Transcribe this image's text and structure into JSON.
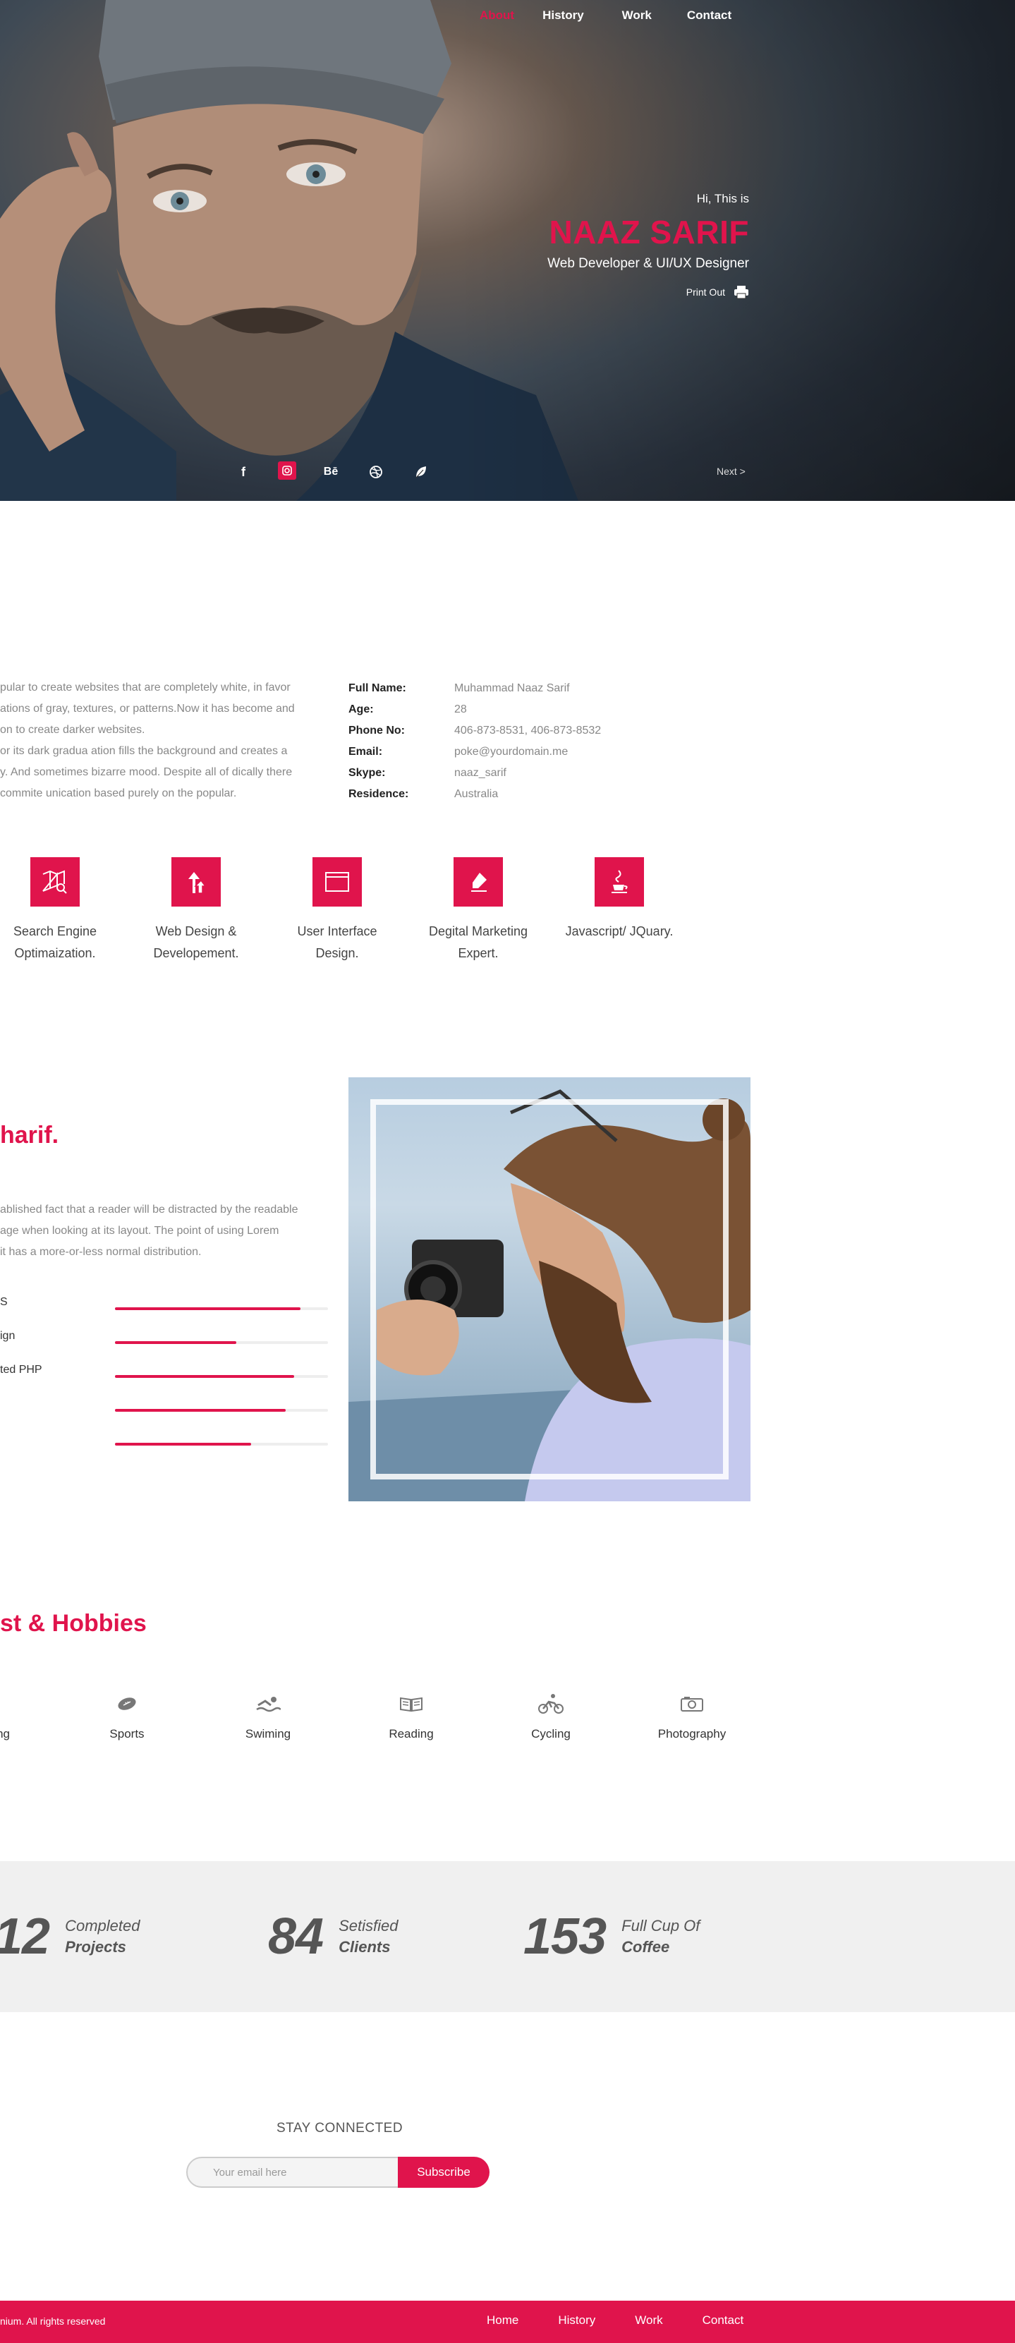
{
  "nav": {
    "items": [
      "About",
      "History",
      "Work",
      "Contact"
    ]
  },
  "hero": {
    "greeting": "Hi, This is",
    "name": "NAAZ SARIF",
    "role": "Web Developer & UI/UX Designer",
    "print_label": "Print Out",
    "next_label": "Next >",
    "social_icons": [
      "facebook-icon",
      "instagram-icon",
      "behance-icon",
      "dribbble-icon",
      "leaf-icon"
    ]
  },
  "about": {
    "text_lines": [
      "pular to create websites that are completely white, in favor",
      "ations of gray, textures, or patterns.Now it has become and",
      "on to create darker websites.",
      "or its dark gradua ation fills the background and creates a",
      "y. And sometimes bizarre mood. Despite all of dically there",
      "commite unication based purely on the popular."
    ],
    "info": [
      {
        "label": "Full Name:",
        "value": "Muhammad Naaz Sarif"
      },
      {
        "label": "Age:",
        "value": "28"
      },
      {
        "label": "Phone No:",
        "value": "406-873-8531, 406-873-8532"
      },
      {
        "label": "Email:",
        "value": "poke@yourdomain.me"
      },
      {
        "label": "Skype:",
        "value": "naaz_sarif"
      },
      {
        "label": "Residence:",
        "value": "Australia"
      }
    ]
  },
  "services": [
    {
      "line1": "Search Engine",
      "line2": "Optimaization.",
      "icon": "map-search-icon"
    },
    {
      "line1": "Web Design &",
      "line2": "Developement.",
      "icon": "upload-arrows-icon"
    },
    {
      "line1": "User Interface",
      "line2": "Design.",
      "icon": "browser-window-icon"
    },
    {
      "line1": "Degital Marketing",
      "line2": "Expert.",
      "icon": "marker-icon"
    },
    {
      "line1": "Javascript/ JQuary.",
      "line2": "",
      "icon": "java-cup-icon"
    }
  ],
  "skills": {
    "title": "harif.",
    "text_lines": [
      "ablished fact that a reader will be distracted by the readable",
      "age when looking at its layout. The point of using Lorem",
      "it has a more-or-less normal distribution."
    ],
    "bars": [
      {
        "label": "S",
        "percent": 87
      },
      {
        "label": "ign",
        "percent": 57
      },
      {
        "label": "ted PHP",
        "percent": 84
      },
      {
        "label": "",
        "percent": 80
      },
      {
        "label": "",
        "percent": 64
      }
    ]
  },
  "hobbies": {
    "title": "st & Hobbies",
    "items": [
      {
        "label": "ng",
        "icon": "gaming-icon"
      },
      {
        "label": "Sports",
        "icon": "football-icon"
      },
      {
        "label": "Swiming",
        "icon": "swimmer-icon"
      },
      {
        "label": "Reading",
        "icon": "open-book-icon"
      },
      {
        "label": "Cycling",
        "icon": "cyclist-icon"
      },
      {
        "label": "Photography",
        "icon": "camera-icon"
      }
    ]
  },
  "stats": [
    {
      "number": "12",
      "line1": "Completed",
      "line2": "Projects"
    },
    {
      "number": "84",
      "line1": "Setisfied",
      "line2": "Clients"
    },
    {
      "number": "153",
      "line1": "Full Cup Of",
      "line2": "Coffee"
    }
  ],
  "newsletter": {
    "title": "STAY CONNECTED",
    "placeholder": "Your email here",
    "button": "Subscribe"
  },
  "footer": {
    "copyright": "nium. All rights reserved",
    "nav": [
      "Home",
      "History",
      "Work",
      "Contact"
    ]
  },
  "colors": {
    "accent": "#e0144c",
    "stats_bg": "#f0f0f0"
  }
}
